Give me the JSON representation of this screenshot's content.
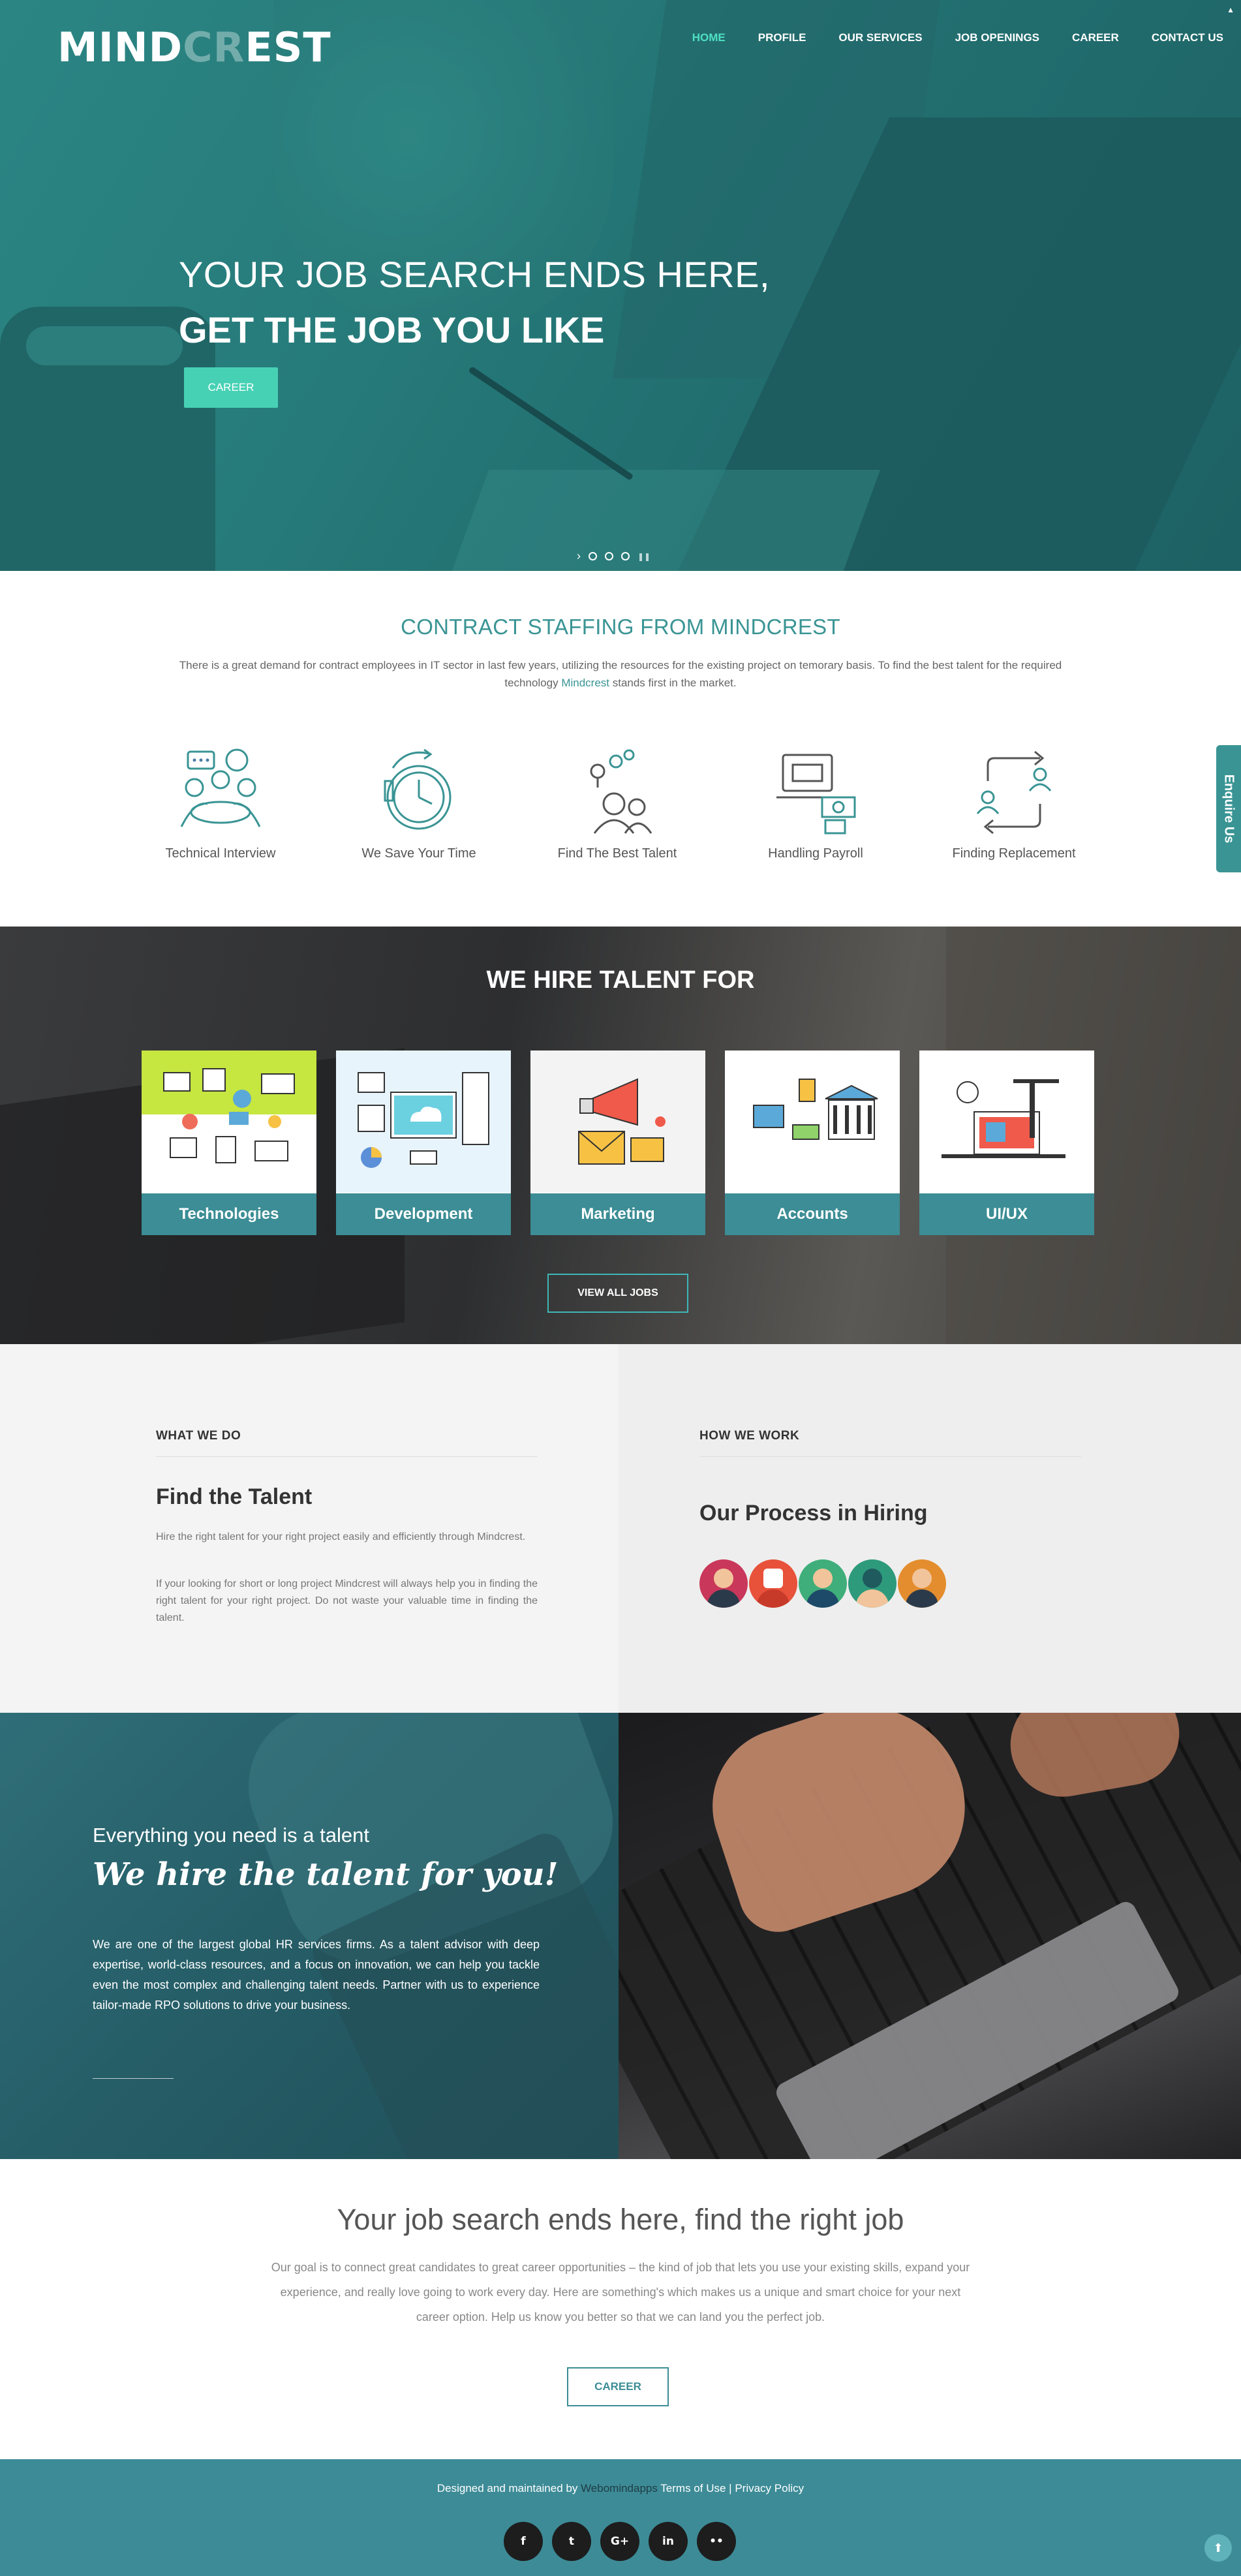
{
  "header": {
    "logo_left": "MIND",
    "logo_mid": "CR",
    "logo_right": "EST",
    "nav": [
      "HOME",
      "PROFILE",
      "OUR SERVICES",
      "JOB OPENINGS",
      "CAREER",
      "CONTACT US"
    ],
    "active_nav": "HOME"
  },
  "hero": {
    "line1": "YOUR JOB SEARCH ENDS HERE,",
    "line2": "GET THE JOB YOU LIKE",
    "button": "CAREER",
    "slide_count": 3
  },
  "contract": {
    "title": "CONTRACT STAFFING FROM MINDCREST",
    "desc_before": "There is a great demand for contract employees in IT sector in last few years, utilizing the resources for the existing project on temorary basis. To find the best talent for the required technology ",
    "desc_link": "Mindcrest",
    "desc_after": " stands first in the market.",
    "features": [
      {
        "label": "Technical Interview",
        "icon": "meeting-icon"
      },
      {
        "label": "We Save Your Time",
        "icon": "clock-icon"
      },
      {
        "label": "Find The Best Talent",
        "icon": "talent-icon"
      },
      {
        "label": "Handling Payroll",
        "icon": "payroll-icon"
      },
      {
        "label": "Finding Replacement",
        "icon": "replacement-icon"
      }
    ],
    "enquire": "Enquire Us"
  },
  "hire": {
    "title": "WE HIRE TALENT FOR",
    "cards": [
      {
        "label": "Technologies",
        "icon": "technologies-illustration"
      },
      {
        "label": "Development",
        "icon": "development-illustration"
      },
      {
        "label": "Marketing",
        "icon": "marketing-illustration"
      },
      {
        "label": "Accounts",
        "icon": "accounts-illustration"
      },
      {
        "label": "UI/UX",
        "icon": "uiux-illustration"
      }
    ],
    "button": "VIEW ALL JOBS"
  },
  "what_we_do": {
    "label": "WHAT WE DO",
    "title": "Find the Talent",
    "p1": "Hire the right talent for your right project easily and efficiently through Mindcrest.",
    "p2": "If your looking for short or long project Mindcrest will always help you in finding the right talent for your right project. Do not waste your valuable time in finding the talent."
  },
  "how_we_work": {
    "label": "HOW WE WORK",
    "title": "Our Process in Hiring",
    "avatar_colors": [
      "#c9375a",
      "#e8513a",
      "#3fae7a",
      "#2e9a7c",
      "#e38d2e"
    ]
  },
  "talent": {
    "line1": "Everything you need is a talent",
    "line2": "We hire the talent for you!",
    "para": "We are one of the largest global HR services firms. As a talent advisor with deep expertise, world-class resources, and a focus on innovation, we can help you tackle even the most complex and challenging talent needs. Partner with us to experience tailor-made RPO solutions to drive your business."
  },
  "jobsearch": {
    "title": "Your job search ends here, find the right job",
    "para": "Our goal is to connect great candidates to great career opportunities – the kind of job that lets you use your existing skills, expand your experience, and really love going to work every day. Here are something's which makes us a unique and smart choice for your next career option. Help us know you better so that we can land you the perfect job.",
    "button": "CAREER"
  },
  "footer": {
    "credit_before": "Designed and maintained by ",
    "credit_brand": "Webomindapps",
    "terms": " Terms of Use",
    "sep": " | ",
    "privacy": "Privacy Policy",
    "socials": [
      {
        "icon": "facebook-icon",
        "glyph": "f"
      },
      {
        "icon": "twitter-icon",
        "glyph": "t"
      },
      {
        "icon": "google-plus-icon",
        "glyph": "G+"
      },
      {
        "icon": "linkedin-icon",
        "glyph": "in"
      },
      {
        "icon": "flickr-icon",
        "glyph": "••"
      }
    ],
    "top_glyph": "⬆"
  }
}
